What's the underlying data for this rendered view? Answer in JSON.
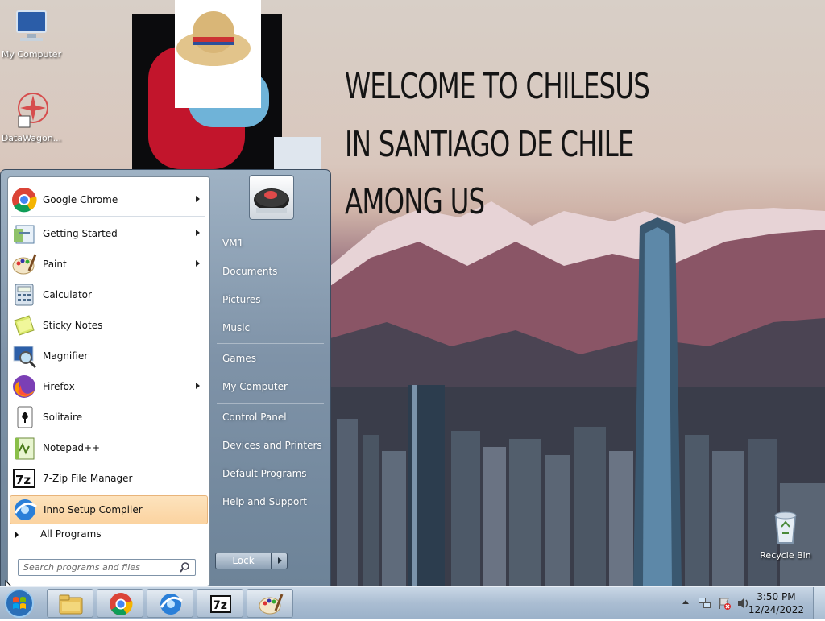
{
  "desktop": {
    "welcome_lines": [
      "WELCOME TO CHILESUS",
      "IN SANTIAGO DE CHILE",
      "AMONG US"
    ],
    "icons": [
      {
        "label": "My Computer",
        "icon": "computer-icon"
      },
      {
        "label": "DataWagon...",
        "icon": "datawagon-icon"
      },
      {
        "label": "Recycle Bin",
        "icon": "recycle-bin-icon"
      }
    ]
  },
  "start_menu": {
    "programs": [
      {
        "label": "Google Chrome",
        "icon": "chrome-icon",
        "submenu": true
      },
      {
        "label": "Getting Started",
        "icon": "getting-started-icon",
        "submenu": true
      },
      {
        "label": "Paint",
        "icon": "paint-icon",
        "submenu": true
      },
      {
        "label": "Calculator",
        "icon": "calculator-icon",
        "submenu": false
      },
      {
        "label": "Sticky Notes",
        "icon": "sticky-notes-icon",
        "submenu": false
      },
      {
        "label": "Magnifier",
        "icon": "magnifier-icon",
        "submenu": false
      },
      {
        "label": "Firefox",
        "icon": "firefox-icon",
        "submenu": true
      },
      {
        "label": "Solitaire",
        "icon": "solitaire-icon",
        "submenu": false
      },
      {
        "label": "Notepad++",
        "icon": "notepadpp-icon",
        "submenu": false
      },
      {
        "label": "7-Zip File Manager",
        "icon": "7zip-icon",
        "submenu": false
      },
      {
        "label": "Inno Setup Compiler",
        "icon": "inno-setup-icon",
        "submenu": false,
        "highlighted": true
      }
    ],
    "all_programs": "All Programs",
    "search_placeholder": "Search programs and files",
    "right_items": [
      "VM1",
      "Documents",
      "Pictures",
      "Music",
      "Games",
      "My Computer",
      "Control Panel",
      "Devices and Printers",
      "Default Programs",
      "Help and Support"
    ],
    "lock_label": "Lock"
  },
  "taskbar": {
    "pinned": [
      {
        "name": "explorer",
        "icon": "folder-icon"
      },
      {
        "name": "chrome",
        "icon": "chrome-icon"
      },
      {
        "name": "inno-setup",
        "icon": "inno-setup-icon"
      },
      {
        "name": "7zip",
        "icon": "7zip-icon"
      },
      {
        "name": "paint",
        "icon": "paint-icon"
      }
    ],
    "time": "3:50 PM",
    "date": "12/24/2022"
  }
}
